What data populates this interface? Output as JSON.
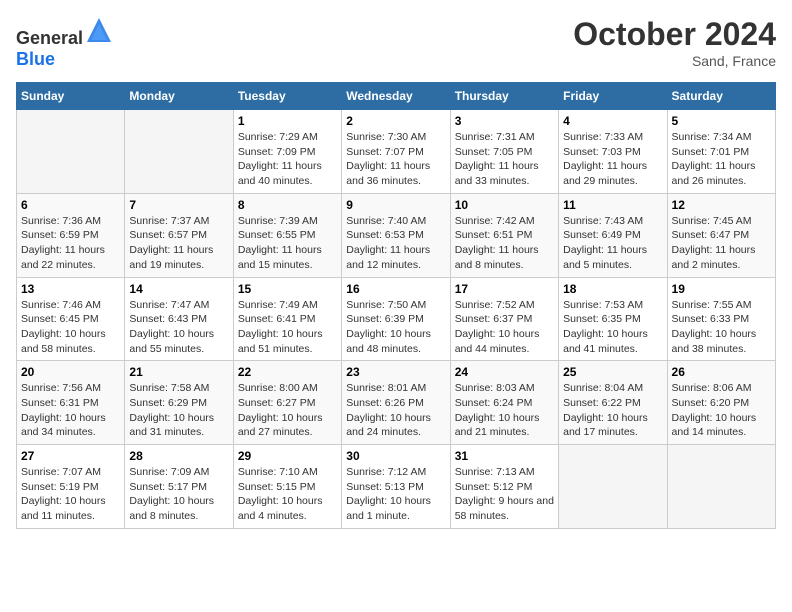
{
  "header": {
    "logo": {
      "text_general": "General",
      "text_blue": "Blue"
    },
    "title": "October 2024",
    "location": "Sand, France"
  },
  "calendar": {
    "days_of_week": [
      "Sunday",
      "Monday",
      "Tuesday",
      "Wednesday",
      "Thursday",
      "Friday",
      "Saturday"
    ],
    "weeks": [
      [
        {
          "day": "",
          "info": ""
        },
        {
          "day": "",
          "info": ""
        },
        {
          "day": "1",
          "info": "Sunrise: 7:29 AM\nSunset: 7:09 PM\nDaylight: 11 hours and 40 minutes."
        },
        {
          "day": "2",
          "info": "Sunrise: 7:30 AM\nSunset: 7:07 PM\nDaylight: 11 hours and 36 minutes."
        },
        {
          "day": "3",
          "info": "Sunrise: 7:31 AM\nSunset: 7:05 PM\nDaylight: 11 hours and 33 minutes."
        },
        {
          "day": "4",
          "info": "Sunrise: 7:33 AM\nSunset: 7:03 PM\nDaylight: 11 hours and 29 minutes."
        },
        {
          "day": "5",
          "info": "Sunrise: 7:34 AM\nSunset: 7:01 PM\nDaylight: 11 hours and 26 minutes."
        }
      ],
      [
        {
          "day": "6",
          "info": "Sunrise: 7:36 AM\nSunset: 6:59 PM\nDaylight: 11 hours and 22 minutes."
        },
        {
          "day": "7",
          "info": "Sunrise: 7:37 AM\nSunset: 6:57 PM\nDaylight: 11 hours and 19 minutes."
        },
        {
          "day": "8",
          "info": "Sunrise: 7:39 AM\nSunset: 6:55 PM\nDaylight: 11 hours and 15 minutes."
        },
        {
          "day": "9",
          "info": "Sunrise: 7:40 AM\nSunset: 6:53 PM\nDaylight: 11 hours and 12 minutes."
        },
        {
          "day": "10",
          "info": "Sunrise: 7:42 AM\nSunset: 6:51 PM\nDaylight: 11 hours and 8 minutes."
        },
        {
          "day": "11",
          "info": "Sunrise: 7:43 AM\nSunset: 6:49 PM\nDaylight: 11 hours and 5 minutes."
        },
        {
          "day": "12",
          "info": "Sunrise: 7:45 AM\nSunset: 6:47 PM\nDaylight: 11 hours and 2 minutes."
        }
      ],
      [
        {
          "day": "13",
          "info": "Sunrise: 7:46 AM\nSunset: 6:45 PM\nDaylight: 10 hours and 58 minutes."
        },
        {
          "day": "14",
          "info": "Sunrise: 7:47 AM\nSunset: 6:43 PM\nDaylight: 10 hours and 55 minutes."
        },
        {
          "day": "15",
          "info": "Sunrise: 7:49 AM\nSunset: 6:41 PM\nDaylight: 10 hours and 51 minutes."
        },
        {
          "day": "16",
          "info": "Sunrise: 7:50 AM\nSunset: 6:39 PM\nDaylight: 10 hours and 48 minutes."
        },
        {
          "day": "17",
          "info": "Sunrise: 7:52 AM\nSunset: 6:37 PM\nDaylight: 10 hours and 44 minutes."
        },
        {
          "day": "18",
          "info": "Sunrise: 7:53 AM\nSunset: 6:35 PM\nDaylight: 10 hours and 41 minutes."
        },
        {
          "day": "19",
          "info": "Sunrise: 7:55 AM\nSunset: 6:33 PM\nDaylight: 10 hours and 38 minutes."
        }
      ],
      [
        {
          "day": "20",
          "info": "Sunrise: 7:56 AM\nSunset: 6:31 PM\nDaylight: 10 hours and 34 minutes."
        },
        {
          "day": "21",
          "info": "Sunrise: 7:58 AM\nSunset: 6:29 PM\nDaylight: 10 hours and 31 minutes."
        },
        {
          "day": "22",
          "info": "Sunrise: 8:00 AM\nSunset: 6:27 PM\nDaylight: 10 hours and 27 minutes."
        },
        {
          "day": "23",
          "info": "Sunrise: 8:01 AM\nSunset: 6:26 PM\nDaylight: 10 hours and 24 minutes."
        },
        {
          "day": "24",
          "info": "Sunrise: 8:03 AM\nSunset: 6:24 PM\nDaylight: 10 hours and 21 minutes."
        },
        {
          "day": "25",
          "info": "Sunrise: 8:04 AM\nSunset: 6:22 PM\nDaylight: 10 hours and 17 minutes."
        },
        {
          "day": "26",
          "info": "Sunrise: 8:06 AM\nSunset: 6:20 PM\nDaylight: 10 hours and 14 minutes."
        }
      ],
      [
        {
          "day": "27",
          "info": "Sunrise: 7:07 AM\nSunset: 5:19 PM\nDaylight: 10 hours and 11 minutes."
        },
        {
          "day": "28",
          "info": "Sunrise: 7:09 AM\nSunset: 5:17 PM\nDaylight: 10 hours and 8 minutes."
        },
        {
          "day": "29",
          "info": "Sunrise: 7:10 AM\nSunset: 5:15 PM\nDaylight: 10 hours and 4 minutes."
        },
        {
          "day": "30",
          "info": "Sunrise: 7:12 AM\nSunset: 5:13 PM\nDaylight: 10 hours and 1 minute."
        },
        {
          "day": "31",
          "info": "Sunrise: 7:13 AM\nSunset: 5:12 PM\nDaylight: 9 hours and 58 minutes."
        },
        {
          "day": "",
          "info": ""
        },
        {
          "day": "",
          "info": ""
        }
      ]
    ]
  }
}
